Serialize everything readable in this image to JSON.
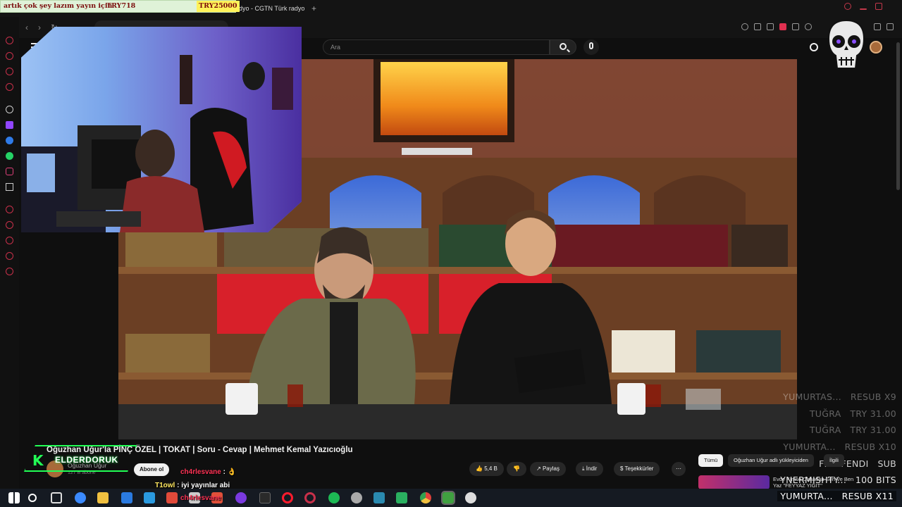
{
  "ticker": {
    "message": "artık çok şey lazım yayın için",
    "amount1": "TRY718",
    "amount2": "TRY25000"
  },
  "browser": {
    "tab_title": "radyo - CGTN Türk radyo"
  },
  "youtube": {
    "search_placeholder": "Ara",
    "video_title": "Oğuzhan Uğur'la PİNÇ ÖZEL | TOKAT | Soru - Cevap | Mehmet Kemal Yazıcıoğlu",
    "channel_name": "Oğuzhan Uğur",
    "subscribers": "127 B abone",
    "subscribe_label": "Abone ol",
    "like_count": "5,4 B",
    "share_label": "Paylaş",
    "download_label": "İndir",
    "thanks_label": "Teşekkürler",
    "chips": [
      "Tümü",
      "Oğuzhan Uğur adlı yükleyiciden",
      "İlgili"
    ],
    "rec_title": "Evde Kimse Olmadan Sen Ve Ben Yaz \"FEYYAZ YİĞİT\""
  },
  "overlay": {
    "logo_text": "ELDERDORUK",
    "chat": [
      {
        "user": "ch4rlesvane",
        "text": "👌"
      },
      {
        "user": "T1owl",
        "text": "iyi yayınlar abi"
      },
      {
        "user": "ch4rlesvane",
        "text": ""
      }
    ],
    "feed": [
      {
        "name": "YUMURTAS...",
        "event": "RESUB X9"
      },
      {
        "name": "TUĞRA",
        "event": "TRY 31.00"
      },
      {
        "name": "TUĞRA",
        "event": "TRY 31.00"
      },
      {
        "name": "YUMURTA...",
        "event": "RESUB X10"
      },
      {
        "name": "FFSEFENDI",
        "event": "SUB"
      },
      {
        "name": "YNERMISHTY...",
        "event": "100 BITS"
      },
      {
        "name": "YUMURTA...",
        "event": "RESUB X11"
      }
    ]
  },
  "colors": {
    "accent": "#c8304a",
    "overlay_green": "#22ff55",
    "ticker_bg": "#dff2d8"
  }
}
